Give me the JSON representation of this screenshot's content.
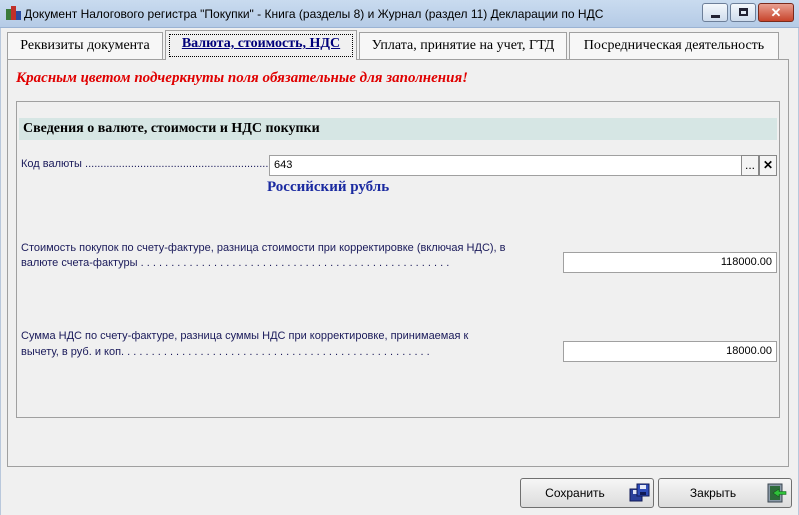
{
  "window": {
    "title": "Документ Налогового регистра \"Покупки\" - Книга (разделы 8) и Журнал (раздел 11) Декларации по НДС"
  },
  "tabs": [
    {
      "label": "Реквизиты документа",
      "active": false
    },
    {
      "label": "Валюта, стоимость, НДС",
      "active": true
    },
    {
      "label": "Уплата, принятие на учет, ГТД",
      "active": false
    },
    {
      "label": "Посредническая деятельность",
      "active": false
    }
  ],
  "notice": "Красным цветом подчеркнуты поля обязательные для заполнения!",
  "section": {
    "title": "Сведения о валюте, стоимости и НДС покупки"
  },
  "fields": {
    "currency_code": {
      "label": "Код валюты ................................................................................",
      "value": "643",
      "select_button": "...",
      "clear_button": "✕",
      "currency_name": "Российский рубль"
    },
    "purchase_cost": {
      "label_line1": "Стоимость покупок по счету-фактуре, разница стоимости при корректировке (включая НДС), в",
      "label_line2": "валюте счета-фактуры . . . . . . . . . . . . . . . . . . . . . . . . . . . . . . . . . . . . . . . . . . . . . . . . . . .",
      "value": "118000.00"
    },
    "vat_amount": {
      "label_line1": "Сумма НДС по счету-фактуре, разница суммы НДС при корректировке, принимаемая к",
      "label_line2": "вычету, в руб. и коп. . . . . . . . . . . . . . . . . . . . . . . . . . . . . . . . . . . . . . . . . . . . . . . . . . .",
      "value": "18000.00"
    }
  },
  "buttons": {
    "save": {
      "label": "Сохранить",
      "icon": "floppy-disks-icon"
    },
    "close": {
      "label": "Закрыть",
      "icon": "exit-door-icon"
    }
  },
  "colors": {
    "notice": "#e00000",
    "section_header_bg": "#d6e6e4",
    "currency_name": "#1a2aa0",
    "active_tab_text": "#00007a"
  }
}
